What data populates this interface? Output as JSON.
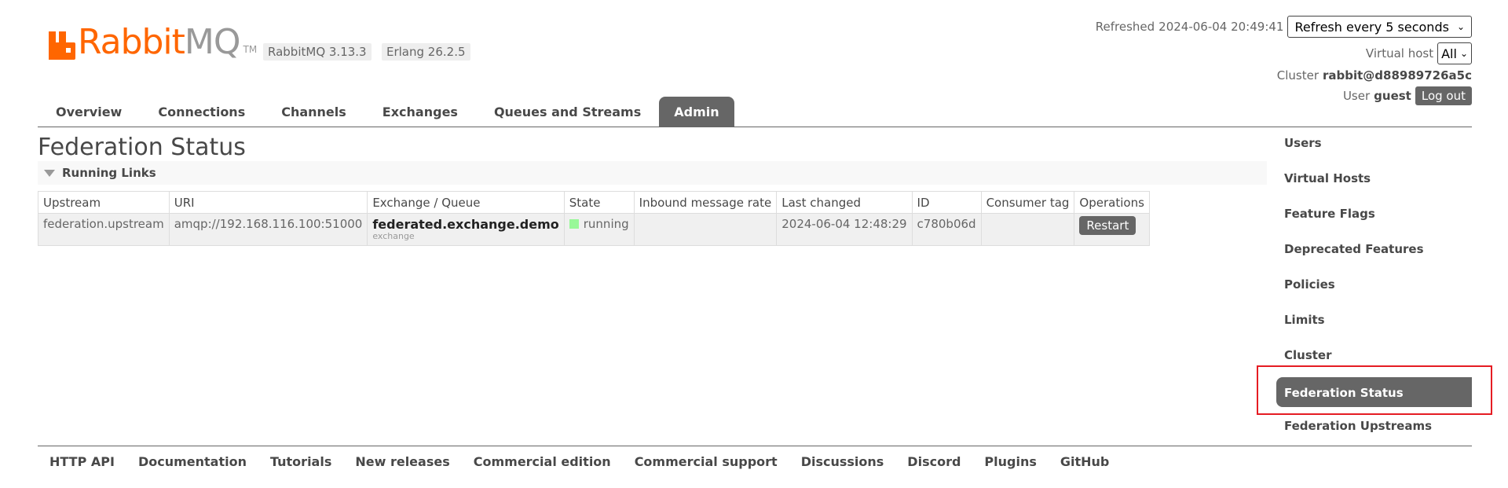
{
  "header": {
    "logo_text_a": "Rabbit",
    "logo_text_b": "MQ",
    "logo_tm": "TM",
    "version_rabbitmq": "RabbitMQ 3.13.3",
    "version_erlang": "Erlang 26.2.5",
    "refreshed_label": "Refreshed",
    "refreshed_time": "2024-06-04 20:49:41",
    "refresh_select": "Refresh every 5 seconds",
    "vhost_label": "Virtual host",
    "vhost_select": "All",
    "cluster_label": "Cluster",
    "cluster_name": "rabbit@d88989726a5c",
    "user_label": "User",
    "user_name": "guest",
    "logout_label": "Log out"
  },
  "tabs": [
    "Overview",
    "Connections",
    "Channels",
    "Exchanges",
    "Queues and Streams",
    "Admin"
  ],
  "active_tab": "Admin",
  "main": {
    "title": "Federation Status",
    "section_label": "Running Links",
    "columns": [
      "Upstream",
      "URI",
      "Exchange / Queue",
      "State",
      "Inbound message rate",
      "Last changed",
      "ID",
      "Consumer tag",
      "Operations"
    ],
    "rows": [
      {
        "upstream": "federation.upstream",
        "uri": "amqp://192.168.116.100:51000",
        "exchange": "federated.exchange.demo",
        "exchange_type": "exchange",
        "state": "running",
        "rate": "",
        "last_changed": "2024-06-04 12:48:29",
        "id": "c780b06d",
        "consumer_tag": "",
        "operation": "Restart"
      }
    ]
  },
  "sidebar": {
    "items": [
      "Users",
      "Virtual Hosts",
      "Feature Flags",
      "Deprecated Features",
      "Policies",
      "Limits",
      "Cluster",
      "Federation Status",
      "Federation Upstreams"
    ],
    "active": "Federation Status"
  },
  "footer": {
    "links": [
      "HTTP API",
      "Documentation",
      "Tutorials",
      "New releases",
      "Commercial edition",
      "Commercial support",
      "Discussions",
      "Discord",
      "Plugins",
      "GitHub"
    ]
  },
  "colors": {
    "brand_orange": "#ff6600",
    "active_tab": "#666666",
    "state_running": "#98f898",
    "highlight_box": "#e51c23"
  }
}
